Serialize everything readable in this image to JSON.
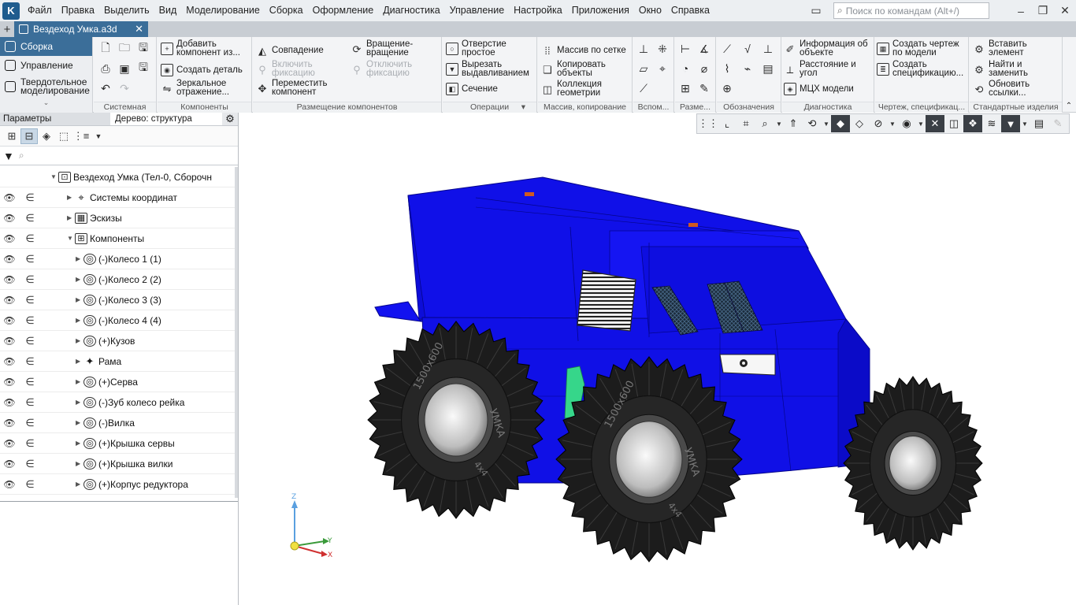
{
  "app": {
    "menu": [
      "Файл",
      "Правка",
      "Выделить",
      "Вид",
      "Моделирование",
      "Сборка",
      "Оформление",
      "Диагностика",
      "Управление",
      "Настройка",
      "Приложения",
      "Окно",
      "Справка"
    ],
    "search_placeholder": "Поиск по командам (Alt+/)"
  },
  "document": {
    "tab_title": "Вездеход Умка.a3d"
  },
  "ribbon": {
    "modes": {
      "assembly": "Сборка",
      "management": "Управление",
      "solid": "Твердотельное моделирование"
    },
    "groups": {
      "system": "Системная",
      "components": "Компоненты",
      "placement": "Размещение компонентов",
      "operations": "Операции",
      "array": "Массив, копирование",
      "aux": "Вспом...",
      "sizes": "Разме...",
      "notation": "Обозначения",
      "diagnostics": "Диагностика",
      "drawing": "Чертеж, спецификац...",
      "standard": "Стандартные изделия"
    },
    "buttons": {
      "add_component": "Добавить компонент из...",
      "create_part": "Создать деталь",
      "mirror": "Зеркальное отражение...",
      "coincidence": "Совпадение",
      "enable_fix": "Включить фиксацию",
      "move_component": "Переместить компонент",
      "rotate_rotate": "Вращение-вращение",
      "disable_fix": "Отключить фиксацию",
      "simple_hole": "Отверстие простое",
      "cut_extrude": "Вырезать выдавливанием",
      "section": "Сечение",
      "grid_array": "Массив по сетке",
      "copy_objects": "Копировать объекты",
      "geometry_collection": "Коллекция геометрии",
      "object_info": "Информация об объекте",
      "distance_angle": "Расстояние и угол",
      "mch_model": "МЦХ модели",
      "create_drawing": "Создать чертеж по модели",
      "create_spec": "Создать спецификацию...",
      "insert_element": "Вставить элемент",
      "find_replace": "Найти и заменить",
      "update_links": "Обновить ссылки..."
    }
  },
  "panel": {
    "tab_params": "Параметры",
    "tab_tree": "Дерево: структура",
    "tree": [
      {
        "label": "Вездеход Умка (Тел-0, Сборочн",
        "indent": 0,
        "icons": false
      },
      {
        "label": "Системы координат",
        "indent": 1,
        "icons": true
      },
      {
        "label": "Эскизы",
        "indent": 1,
        "icons": true
      },
      {
        "label": "Компоненты",
        "indent": 1,
        "icons": true
      },
      {
        "label": "(-)Колесо 1 (1)",
        "indent": 2,
        "icons": true
      },
      {
        "label": "(-)Колесо 2 (2)",
        "indent": 2,
        "icons": true
      },
      {
        "label": "(-)Колесо 3 (3)",
        "indent": 2,
        "icons": true
      },
      {
        "label": "(-)Колесо 4 (4)",
        "indent": 2,
        "icons": true
      },
      {
        "label": "(+)Кузов",
        "indent": 2,
        "icons": true
      },
      {
        "label": "Рама",
        "indent": 2,
        "icons": true
      },
      {
        "label": "(+)Серва",
        "indent": 2,
        "icons": true
      },
      {
        "label": "(-)Зуб колесо рейка",
        "indent": 2,
        "icons": true
      },
      {
        "label": "(-)Вилка",
        "indent": 2,
        "icons": true
      },
      {
        "label": "(+)Крышка сервы",
        "indent": 2,
        "icons": true
      },
      {
        "label": "(+)Крышка вилки",
        "indent": 2,
        "icons": true
      },
      {
        "label": "(+)Корпус редуктора",
        "indent": 2,
        "icons": true
      }
    ]
  },
  "model": {
    "tire_text": "1500x600",
    "brand_text": "УМКА",
    "drive_text": "4x4",
    "body_color": "#1010e8",
    "tire_color": "#1c1c1c",
    "accent_color": "#3b6e99"
  },
  "axes": {
    "x": "X",
    "y": "Y",
    "z": "Z"
  }
}
